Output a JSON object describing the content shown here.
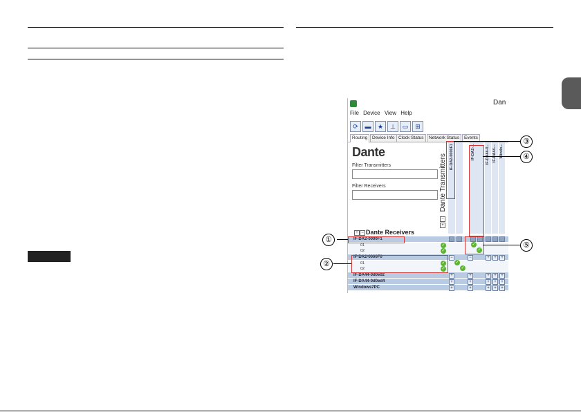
{
  "window": {
    "title": "Dan"
  },
  "menu": [
    "File",
    "Device",
    "View",
    "Help"
  ],
  "toolbar_icons": [
    "refresh-icon",
    "folder-icon",
    "star-icon",
    "network-icon",
    "media-icon",
    "grid-icon"
  ],
  "tabs": [
    "Routing",
    "Device Info",
    "Clock Status",
    "Network Status",
    "Events"
  ],
  "logo": "Dante",
  "filters": {
    "transmitters_label": "Filter Transmitters",
    "receivers_label": "Filter Receivers"
  },
  "transmitters_label": "Dante Transmitters",
  "receivers_label": "Dante Receivers",
  "transmitter_columns": [
    "IF-DA2-0000F1",
    "",
    "IF-DA2-...",
    "IF-DA44-0...",
    "IF-DA44-...",
    "Windo..."
  ],
  "receivers": [
    {
      "name": "IF-DA2-0000F1",
      "channels": [
        "01",
        "02"
      ]
    },
    {
      "name": "IF-DA2-0000F0",
      "channels": [
        "01",
        "02"
      ]
    },
    {
      "name": "IF-DA44-0d0e02",
      "channels": []
    },
    {
      "name": "IF-DA44-0d0ed4",
      "channels": []
    },
    {
      "name": "Windows7PC",
      "channels": []
    }
  ],
  "callouts": [
    "①",
    "②",
    "③",
    "④",
    "⑤"
  ],
  "expander_minus": "−",
  "expander_plus": "+",
  "check_glyph": "✓"
}
